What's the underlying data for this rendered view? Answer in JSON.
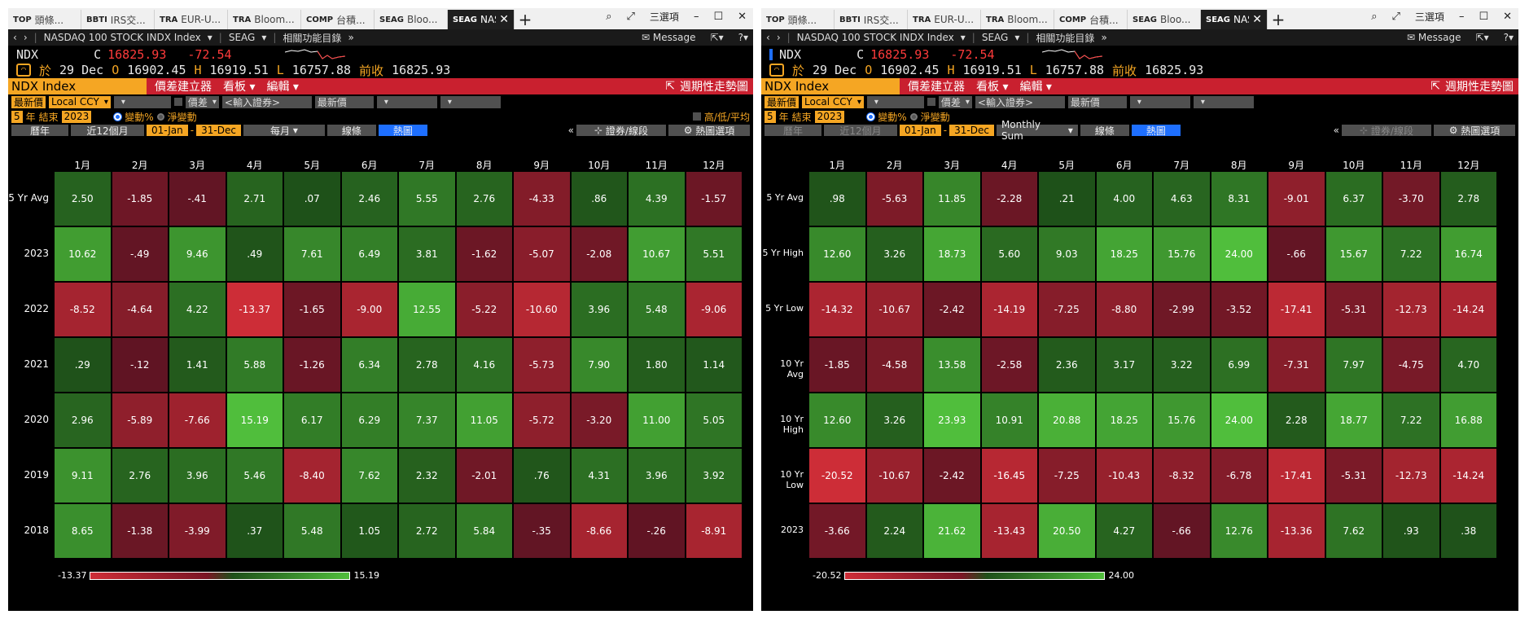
{
  "tabs": [
    {
      "code": "TOP",
      "name": "頭條..."
    },
    {
      "code": "BBTI",
      "name": "IRS交..."
    },
    {
      "code": "TRA",
      "name": "EUR-U..."
    },
    {
      "code": "TRA",
      "name": "Bloom..."
    },
    {
      "code": "COMP",
      "name": "台積..."
    },
    {
      "code": "SEAG",
      "name": "Bloo..."
    },
    {
      "code": "SEAG",
      "name": "NASI"
    }
  ],
  "window_controls": {
    "options": "三選項"
  },
  "nav": {
    "security": "NASDAQ 100 STOCK INDX Index",
    "fn": "SEAG",
    "related": "相關功能目錄",
    "message": "Message"
  },
  "quote": {
    "ticker": "NDX",
    "c_label": "C",
    "price": "16825.93",
    "change": "-72.54",
    "at_label": "於",
    "date": "29 Dec",
    "o_label": "O",
    "open": "16902.45",
    "h_label": "H",
    "high": "16919.51",
    "l_label": "L",
    "low": "16757.88",
    "prev_label": "前收",
    "prev": "16825.93"
  },
  "section": {
    "name": "NDX Index",
    "buttons": [
      "價差建立器",
      "看板",
      "編輯"
    ],
    "right": "週期性走勢圖"
  },
  "controls": {
    "latest_price": "最新價",
    "ccy": "Local CCY",
    "spread": "價差",
    "input_security": "<輸入證券>",
    "latest_price2": "最新價",
    "years": "5",
    "year_label": "年",
    "end_label": "結束",
    "end_year": "2023",
    "change_pct": "變動%",
    "net_change": "淨變動",
    "hilo_avg": "高/低/平均"
  },
  "toolbar_left": {
    "calendar": "曆年",
    "last12": "近12個月",
    "from": "01-Jan",
    "dash": "-",
    "to": "31-Dec",
    "monthly": "每月",
    "line": "線條",
    "heatmap": "熱圖",
    "collapse": "«",
    "sec_line": "證券/線段",
    "heat_opts": "熱圖選項"
  },
  "toolbar_right": {
    "calendar": "曆年",
    "last12": "近12個月",
    "from": "01-Jan",
    "dash": "-",
    "to": "31-Dec",
    "monthly": "Monthly Sum",
    "line": "線條",
    "heatmap": "熱圖",
    "collapse": "«",
    "sec_line": "證券/線段",
    "heat_opts": "熱圖選項"
  },
  "chart_data": [
    {
      "type": "heatmap",
      "columns": [
        "1月",
        "2月",
        "3月",
        "4月",
        "5月",
        "6月",
        "7月",
        "8月",
        "9月",
        "10月",
        "11月",
        "12月"
      ],
      "rows": [
        "5 Yr Avg",
        "2023",
        "2022",
        "2021",
        "2020",
        "2019",
        "2018"
      ],
      "values": [
        [
          "2.50",
          "-1.85",
          "-.41",
          "2.71",
          ".07",
          "2.46",
          "5.55",
          "2.76",
          "-4.33",
          ".86",
          "4.39",
          "-1.57"
        ],
        [
          "10.62",
          "-.49",
          "9.46",
          ".49",
          "7.61",
          "6.49",
          "3.81",
          "-1.62",
          "-5.07",
          "-2.08",
          "10.67",
          "5.51"
        ],
        [
          "-8.52",
          "-4.64",
          "4.22",
          "-13.37",
          "-1.65",
          "-9.00",
          "12.55",
          "-5.22",
          "-10.60",
          "3.96",
          "5.48",
          "-9.06"
        ],
        [
          ".29",
          "-.12",
          "1.41",
          "5.88",
          "-1.26",
          "6.34",
          "2.78",
          "4.16",
          "-5.73",
          "7.90",
          "1.80",
          "1.14"
        ],
        [
          "2.96",
          "-5.89",
          "-7.66",
          "15.19",
          "6.17",
          "6.29",
          "7.37",
          "11.05",
          "-5.72",
          "-3.20",
          "11.00",
          "5.05"
        ],
        [
          "9.11",
          "2.76",
          "3.96",
          "5.46",
          "-8.40",
          "7.62",
          "2.32",
          "-2.01",
          ".76",
          "4.31",
          "3.96",
          "3.92"
        ],
        [
          "8.65",
          "-1.38",
          "-3.99",
          ".37",
          "5.48",
          "1.05",
          "2.72",
          "5.84",
          "-.35",
          "-8.66",
          "-.26",
          "-8.91"
        ]
      ],
      "min": "-13.37",
      "max": "15.19"
    },
    {
      "type": "heatmap",
      "columns": [
        "1月",
        "2月",
        "3月",
        "4月",
        "5月",
        "6月",
        "7月",
        "8月",
        "9月",
        "10月",
        "11月",
        "12月"
      ],
      "rows": [
        "5 Yr Avg",
        "5 Yr High",
        "5 Yr Low",
        "10 Yr Avg",
        "10 Yr High",
        "10 Yr Low",
        "2023"
      ],
      "values": [
        [
          ".98",
          "-5.63",
          "11.85",
          "-2.28",
          ".21",
          "4.00",
          "4.63",
          "8.31",
          "-9.01",
          "6.37",
          "-3.70",
          "2.78"
        ],
        [
          "12.60",
          "3.26",
          "18.73",
          "5.60",
          "9.03",
          "18.25",
          "15.76",
          "24.00",
          "-.66",
          "15.67",
          "7.22",
          "16.74"
        ],
        [
          "-14.32",
          "-10.67",
          "-2.42",
          "-14.19",
          "-7.25",
          "-8.80",
          "-2.99",
          "-3.52",
          "-17.41",
          "-5.31",
          "-12.73",
          "-14.24"
        ],
        [
          "-1.85",
          "-4.58",
          "13.58",
          "-2.58",
          "2.36",
          "3.17",
          "3.22",
          "6.99",
          "-7.31",
          "7.97",
          "-4.75",
          "4.70"
        ],
        [
          "12.60",
          "3.26",
          "23.93",
          "10.91",
          "20.88",
          "18.25",
          "15.76",
          "24.00",
          "2.28",
          "18.77",
          "7.22",
          "16.88"
        ],
        [
          "-20.52",
          "-10.67",
          "-2.42",
          "-16.45",
          "-7.25",
          "-10.43",
          "-8.32",
          "-6.78",
          "-17.41",
          "-5.31",
          "-12.73",
          "-14.24"
        ],
        [
          "-3.66",
          "2.24",
          "21.62",
          "-13.43",
          "20.50",
          "4.27",
          "-.66",
          "12.76",
          "-13.36",
          "7.62",
          ".93",
          ".38"
        ]
      ],
      "min": "-20.52",
      "max": "24.00"
    }
  ]
}
